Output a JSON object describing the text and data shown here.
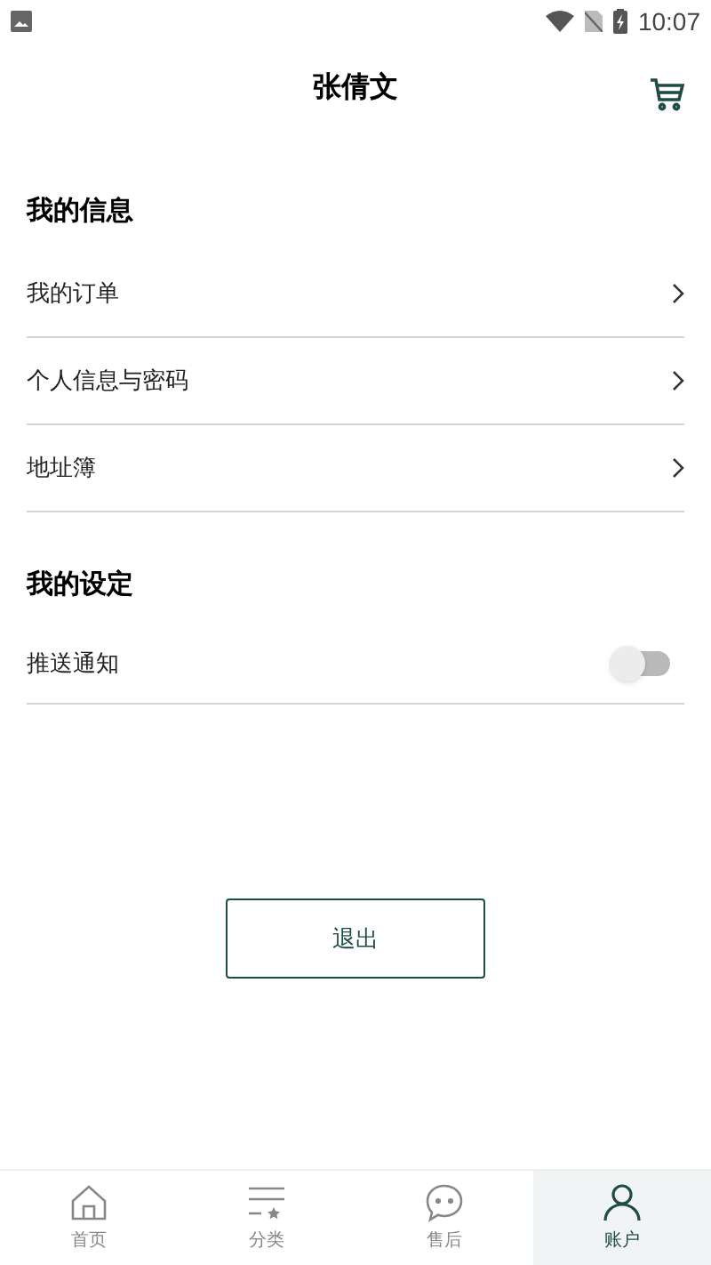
{
  "status_bar": {
    "time": "10:07"
  },
  "header": {
    "title": "张倩文"
  },
  "sections": [
    {
      "title": "我的信息",
      "items": [
        {
          "kind": "link",
          "label": "我的订单"
        },
        {
          "kind": "link",
          "label": "个人信息与密码"
        },
        {
          "kind": "link",
          "label": "地址簿"
        }
      ]
    },
    {
      "title": "我的设定",
      "items": [
        {
          "kind": "toggle",
          "label": "推送通知",
          "on": false
        }
      ]
    }
  ],
  "logout_button": "退出",
  "bottom_nav": [
    {
      "label": "首页",
      "selected": false
    },
    {
      "label": "分类",
      "selected": false
    },
    {
      "label": "售后",
      "selected": false
    },
    {
      "label": "账户",
      "selected": true
    }
  ]
}
